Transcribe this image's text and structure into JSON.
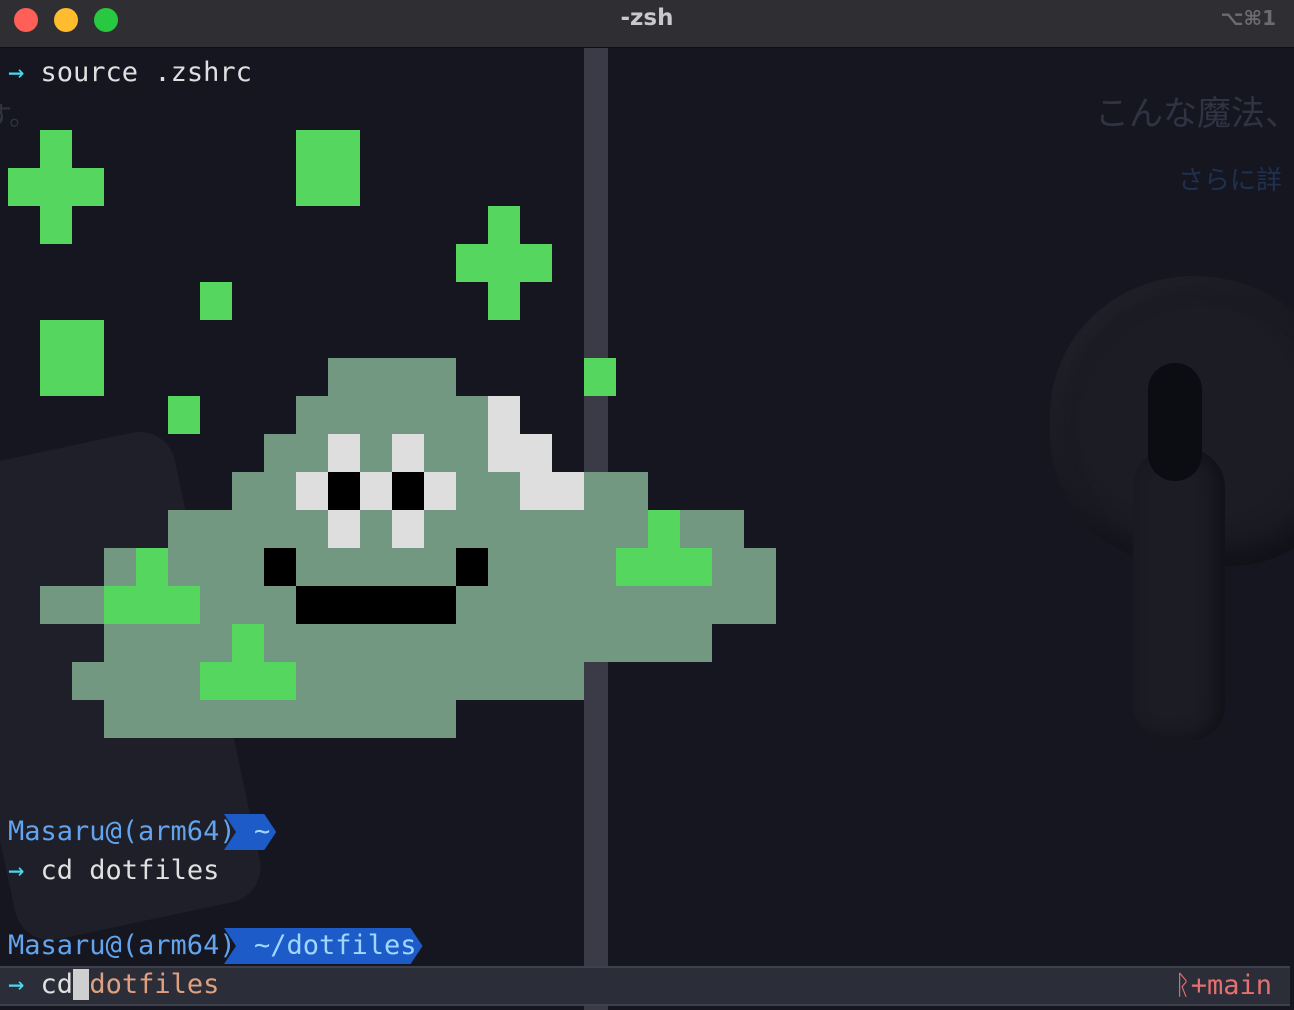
{
  "window": {
    "title": "-zsh",
    "shortcut": "⌥⌘1",
    "traffic_lights": {
      "close": "#fe5f57",
      "minimize": "#febc2e",
      "zoom": "#28c840"
    }
  },
  "background": {
    "jp_heading": "こんな魔法、",
    "jp_link": "さらに詳",
    "jp_fragment": "す。"
  },
  "terminal": {
    "prompt_symbol": "→",
    "line1_command": "source .zshrc",
    "prompt1_user": "Masaru@(arm64)",
    "prompt1_dir": "~",
    "line2_command": "cd dotfiles",
    "prompt2_user": "Masaru@(arm64)",
    "prompt2_dir": "~/dotfiles",
    "line3_cmd": "cd",
    "line3_arg": "dotfiles",
    "git_branch": "ᚱ+main"
  },
  "colors": {
    "pixel_green": "#55d75f",
    "slime_body": "#729882",
    "prompt_user": "#62a4ee",
    "prompt_dir_bg": "#1d5bc9",
    "arrow": "#4fd6ea",
    "branch": "#e47070"
  }
}
